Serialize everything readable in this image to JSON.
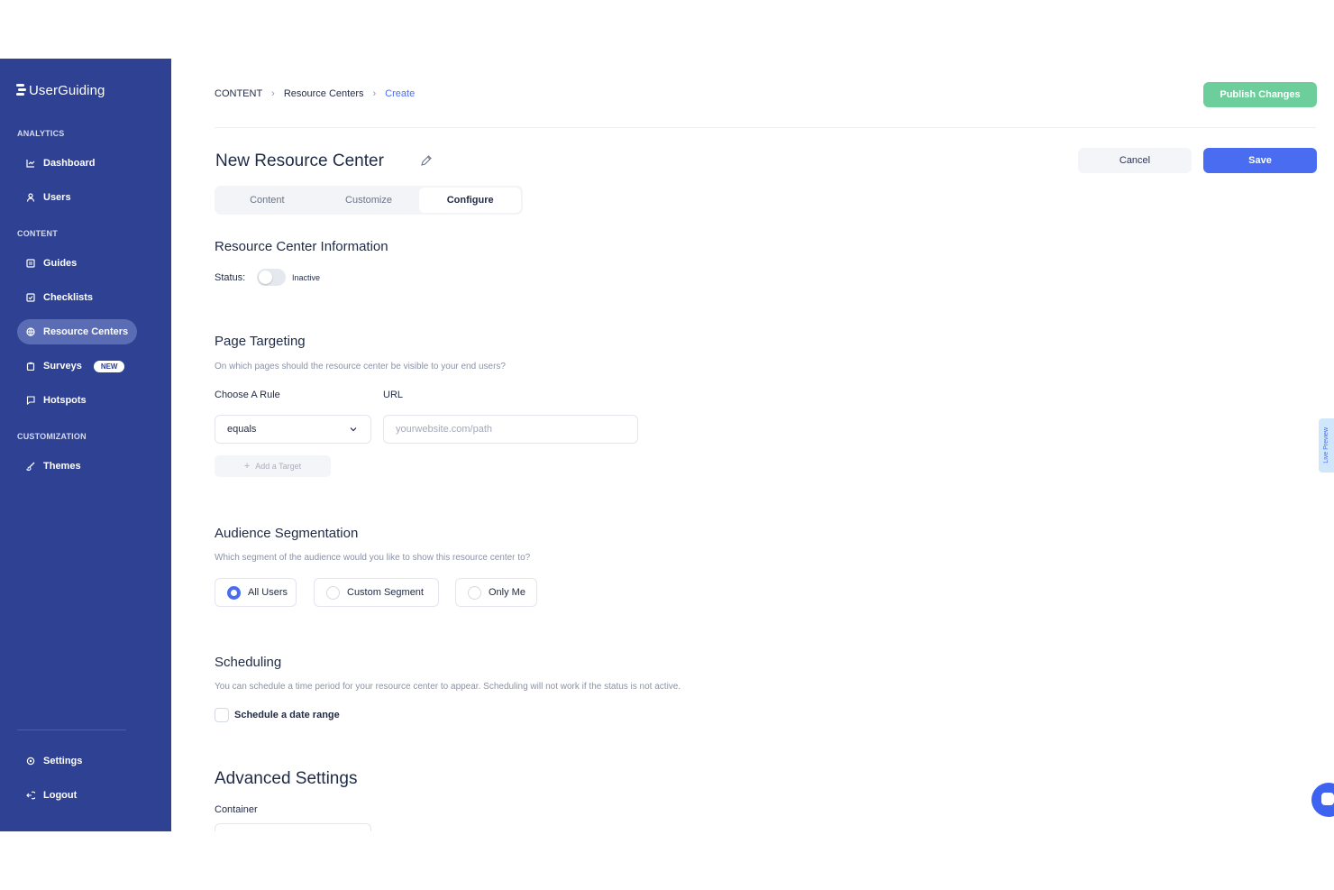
{
  "sidebar": {
    "logo": "UserGuiding",
    "sections": {
      "analytics": "ANALYTICS",
      "content": "CONTENT",
      "customization": "CUSTOMIZATION"
    },
    "items": {
      "dashboard": "Dashboard",
      "users": "Users",
      "guides": "Guides",
      "checklists": "Checklists",
      "resource_centers": "Resource Centers",
      "surveys": "Surveys",
      "surveys_badge": "NEW",
      "hotspots": "Hotspots",
      "themes": "Themes",
      "settings": "Settings",
      "logout": "Logout"
    },
    "active_item": "resource_centers"
  },
  "breadcrumb": [
    "CONTENT",
    "Resource Centers",
    "Create"
  ],
  "header": {
    "publish_label": "Publish Changes",
    "title": "New Resource Center",
    "cancel_label": "Cancel",
    "save_label": "Save"
  },
  "tabs": {
    "items": [
      "Content",
      "Customize",
      "Configure"
    ],
    "active": "Configure"
  },
  "info": {
    "heading": "Resource Center Information",
    "status_label": "Status:",
    "status_value": "Inactive"
  },
  "targeting": {
    "heading": "Page Targeting",
    "description": "On which pages should the resource center be visible to your end users?",
    "rule_label": "Choose A Rule",
    "url_label": "URL",
    "rule_value": "equals",
    "url_placeholder": "yourwebsite.com/path",
    "add_target_label": "Add a Target"
  },
  "audience": {
    "heading": "Audience Segmentation",
    "description": "Which segment of the audience would you like to show this resource center to?",
    "options": [
      "All Users",
      "Custom Segment",
      "Only Me"
    ],
    "selected": "All Users"
  },
  "scheduling": {
    "heading": "Scheduling",
    "description": "You can schedule a time period for your resource center to appear. Scheduling will not work if the status is not active.",
    "checkbox_label": "Schedule a date range"
  },
  "advanced": {
    "heading": "Advanced Settings",
    "container_label": "Container"
  },
  "live_preview_label": "Live Preview",
  "colors": {
    "sidebar_bg": "#2e4193",
    "accent": "#4a6cf0",
    "publish": "#6ccf9b"
  }
}
